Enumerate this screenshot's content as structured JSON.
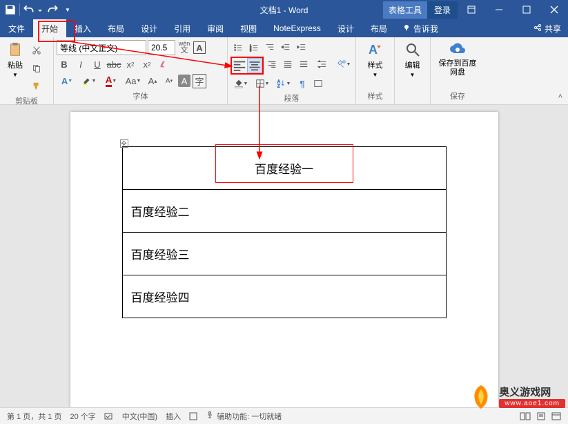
{
  "title": {
    "doc": "文档1",
    "app": "Word"
  },
  "titlebar": {
    "table_tools": "表格工具",
    "login": "登录"
  },
  "tabs": {
    "file": "文件",
    "home": "开始",
    "insert": "插入",
    "layout": "布局",
    "design": "设计",
    "references": "引用",
    "review": "审阅",
    "view": "视图",
    "noteexpress": "NoteExpress",
    "table_design": "设计",
    "table_layout": "布局",
    "tellme": "告诉我",
    "share": "共享"
  },
  "ribbon": {
    "clipboard": {
      "paste": "粘贴",
      "label": "剪贴板"
    },
    "font": {
      "name": "等线 (中文正文)",
      "size": "20.5",
      "label": "字体"
    },
    "paragraph": {
      "label": "段落"
    },
    "styles": {
      "btn": "样式",
      "label": "样式"
    },
    "editing": {
      "btn": "编辑"
    },
    "save": {
      "btn": "保存到百度网盘",
      "label": "保存"
    }
  },
  "table": {
    "rows": [
      "百度经验一",
      "百度经验二",
      "百度经验三",
      "百度经验四"
    ]
  },
  "status": {
    "page": "第 1 页，共 1 页",
    "words": "20 个字",
    "lang": "中文(中国)",
    "mode": "插入",
    "accessibility": "辅助功能: 一切就绪"
  },
  "watermark": {
    "cn": "奥义游戏网",
    "url": "www.aoe1.com"
  }
}
